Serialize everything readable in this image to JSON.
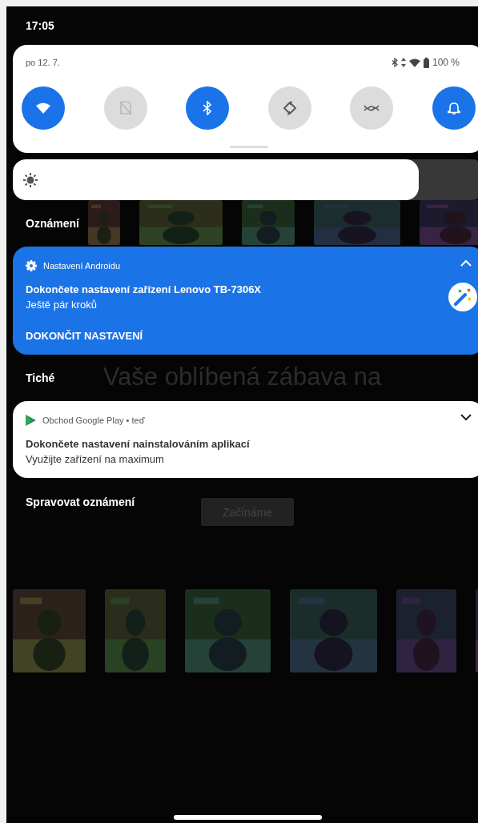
{
  "status_bar": {
    "time": "17:05"
  },
  "background_app": {
    "heading_lines": [
      "Vaše oblíbená zábava na"
    ],
    "start_button": "Začínáme"
  },
  "quick_settings": {
    "date": "po 12. 7.",
    "battery": "100 %",
    "tiles": [
      {
        "on": true,
        "disabled": false
      },
      {
        "on": false,
        "disabled": true
      },
      {
        "on": true,
        "disabled": false
      },
      {
        "on": false,
        "disabled": false
      },
      {
        "on": false,
        "disabled": false
      },
      {
        "on": true,
        "disabled": false
      }
    ]
  },
  "brightness": {
    "level": 0.86
  },
  "sections": [
    {
      "title": "Oznámení",
      "notifications": [
        {
          "app": "Nastavení Androidu",
          "title": "Dokončete nastavení zařízení Lenovo TB-7306X",
          "text": "Ještě pár kroků",
          "action": "DOKONČIT NASTAVENÍ",
          "expanded": true,
          "highlighted": true
        }
      ]
    },
    {
      "title": "Tiché",
      "notifications": [
        {
          "app": "Obchod Google Play • teď",
          "title": "Dokončete nastavení nainstalováním aplikací",
          "text": "Využijte zařízení na maximum",
          "expanded": false,
          "highlighted": false
        }
      ]
    }
  ],
  "manage_link": "Spravovat oznámení"
}
